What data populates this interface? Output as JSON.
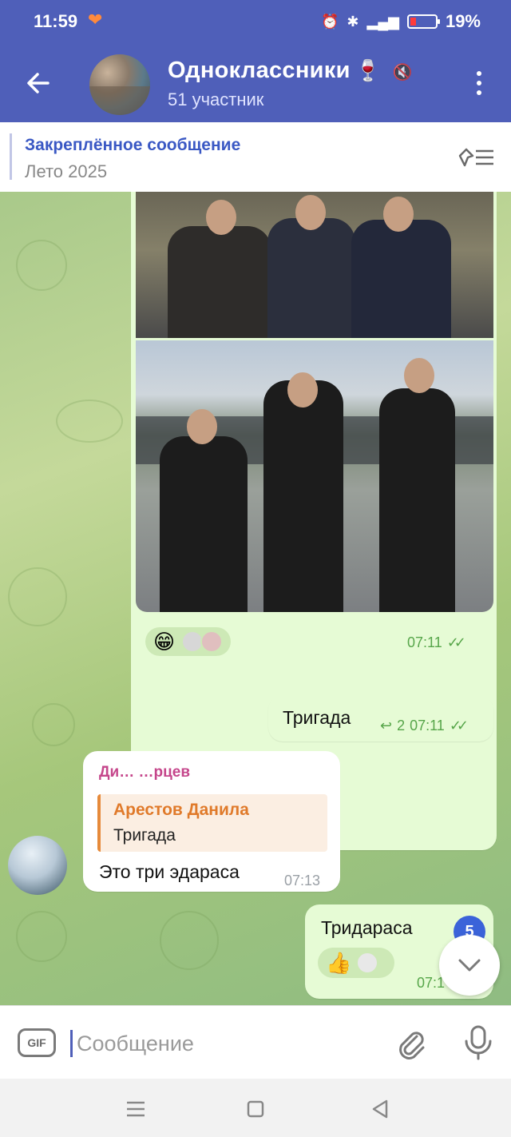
{
  "status_bar": {
    "time": "11:59",
    "battery_percent": "19%",
    "icons": [
      "heart-icon",
      "alarm-icon",
      "bluetooth-icon",
      "signal-4g-icon",
      "battery-icon"
    ]
  },
  "chat_header": {
    "title": "Одноклассники",
    "title_emoji": "🍷",
    "subtitle": "51 участник",
    "back_icon": "arrow-left-icon",
    "mute_icon": "muted-icon",
    "menu_icon": "more-vertical-icon"
  },
  "pinned": {
    "title": "Закреплённое сообщение",
    "text": "Лето 2025",
    "icon": "pin-list-icon"
  },
  "messages": [
    {
      "type": "outgoing-photo",
      "reaction_emoji": "😁",
      "time": "07:11"
    },
    {
      "type": "outgoing-text",
      "text": "Тригада",
      "reply_count": "2",
      "time": "07:11"
    },
    {
      "type": "incoming-reply",
      "sender": "Ди… …рцев",
      "reply_to_name": "Арестов Данила",
      "reply_to_text": "Тригада",
      "text": "Это три эдараса",
      "time": "07:13"
    },
    {
      "type": "outgoing-text",
      "text": "Тридараса",
      "reaction_emoji": "👍",
      "time": "07:1"
    }
  ],
  "unread_count": "5",
  "composer": {
    "gif_label": "GIF",
    "placeholder": "Сообщение",
    "value": ""
  },
  "colors": {
    "header": "#4f5fb9",
    "outgoing_bubble": "#e6fbd5",
    "link_blue": "#3a58c4",
    "ticks_green": "#57a64a",
    "sender_pink": "#c5468b",
    "reply_orange": "#e07a2a"
  }
}
